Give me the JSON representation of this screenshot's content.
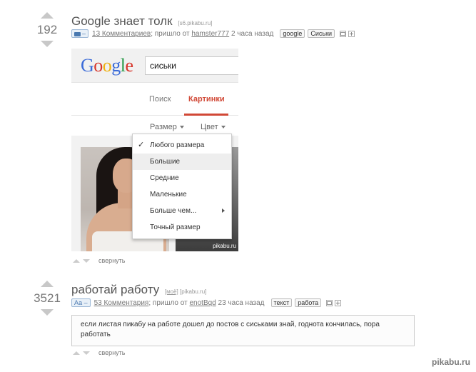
{
  "posts": [
    {
      "rating": "192",
      "title": "Google знает толк",
      "domain": "[s6.pikabu.ru]",
      "badge": "–",
      "comments": "13 Комментариев",
      "from_prefix": "; пришло от",
      "author": "hamster777",
      "time": "2 часа назад",
      "tags": [
        "google",
        "Сиськи"
      ],
      "collapse": "свернуть"
    },
    {
      "rating": "3521",
      "title": "работай работу",
      "domain_tag": "[моё]",
      "domain": "[pikabu.ru]",
      "badge": "Аа –",
      "comments": "53 Комментария",
      "from_prefix": "; пришло от",
      "author": "enotBqd",
      "time": "23 часа назад",
      "tags": [
        "текст",
        "работа"
      ],
      "text": "если листая пикабу на работе дошел до постов с сиськами знай, годнота кончилась, пора работать",
      "collapse": "свернуть"
    }
  ],
  "google": {
    "logo_letters": [
      "G",
      "o",
      "o",
      "g",
      "l",
      "e"
    ],
    "query": "сиськи",
    "tabs": [
      "Поиск",
      "Картинки"
    ],
    "filters": [
      "Размер",
      "Цвет"
    ],
    "menu_items": [
      "Любого размера",
      "Большие",
      "Средние",
      "Маленькие",
      "Больше чем...",
      "Точный размер"
    ],
    "watermark": "pikabu.ru"
  },
  "footer": {
    "logo": "pikabu.ru"
  }
}
